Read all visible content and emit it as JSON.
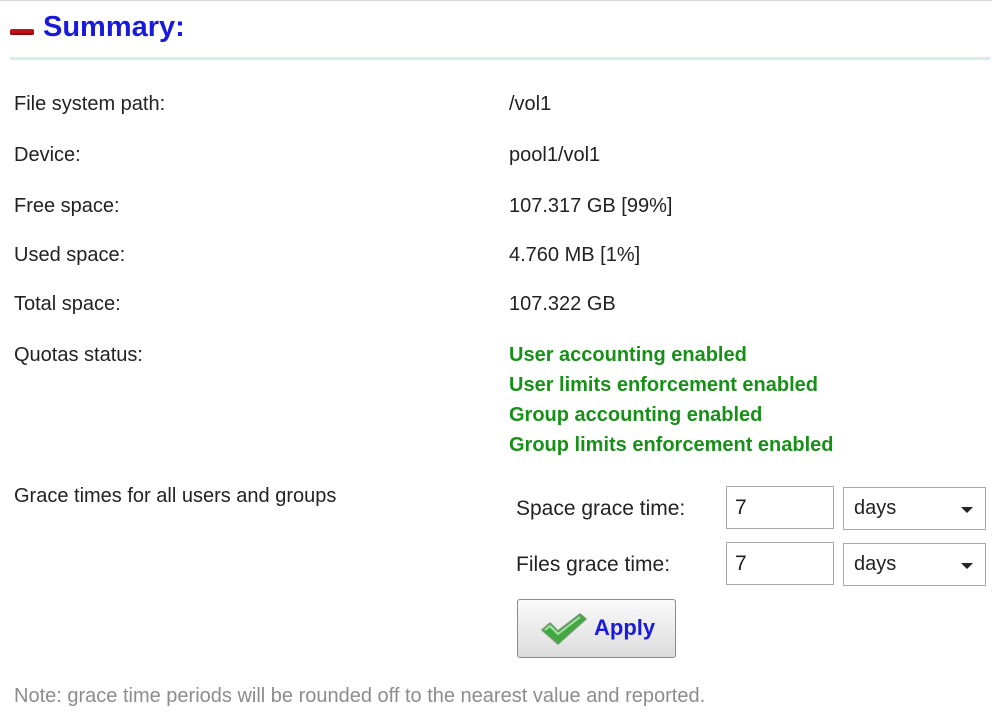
{
  "header": {
    "title": "Summary:"
  },
  "summary": {
    "path_label": "File system path:",
    "path_value": "/vol1",
    "device_label": "Device:",
    "device_value": "pool1/vol1",
    "free_label": "Free space:",
    "free_value": "107.317 GB [99%]",
    "used_label": "Used space:",
    "used_value": "4.760 MB [1%]",
    "total_label": "Total space:",
    "total_value": "107.322 GB",
    "quotas_label": "Quotas status:",
    "quotas": [
      "User accounting enabled",
      "User limits enforcement enabled",
      "Group accounting enabled",
      "Group limits enforcement enabled"
    ]
  },
  "grace": {
    "section_label": "Grace times for all users and groups",
    "space_label": "Space grace time:",
    "space_value": "7",
    "space_unit": "days",
    "files_label": "Files grace time:",
    "files_value": "7",
    "files_unit": "days",
    "apply_label": "Apply"
  },
  "note": "Note: grace time periods will be rounded off to the nearest value and reported.",
  "colors": {
    "title": "#1a1adb",
    "quota_status": "#179017",
    "collapse_icon": "#c0121b",
    "note": "#8c8c8c"
  },
  "icons": {
    "collapse": "minus-icon",
    "apply": "checkmark-icon",
    "dropdown": "chevron-down-icon"
  }
}
